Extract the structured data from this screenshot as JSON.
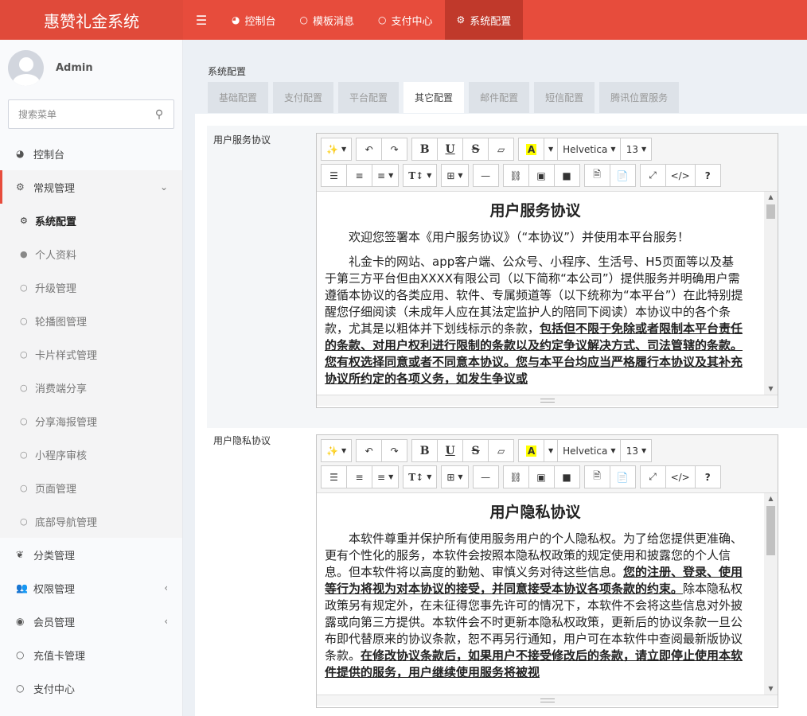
{
  "app": {
    "title": "惠赞礼金系统"
  },
  "topnav": {
    "items": [
      {
        "label": "控制台",
        "icon": "dashboard-icon"
      },
      {
        "label": "模板消息",
        "icon": "circle-icon"
      },
      {
        "label": "支付中心",
        "icon": "circle-icon"
      },
      {
        "label": "系统配置",
        "icon": "gear-icon"
      }
    ]
  },
  "user": {
    "name": "Admin"
  },
  "search": {
    "placeholder": "搜索菜单"
  },
  "sidebar": {
    "items": [
      {
        "label": "控制台"
      },
      {
        "label": "常规管理"
      },
      {
        "label": "系统配置"
      },
      {
        "label": "个人资料"
      },
      {
        "label": "升级管理"
      },
      {
        "label": "轮播图管理"
      },
      {
        "label": "卡片样式管理"
      },
      {
        "label": "消费端分享"
      },
      {
        "label": "分享海报管理"
      },
      {
        "label": "小程序审核"
      },
      {
        "label": "页面管理"
      },
      {
        "label": "底部导航管理"
      },
      {
        "label": "分类管理"
      },
      {
        "label": "权限管理"
      },
      {
        "label": "会员管理"
      },
      {
        "label": "充值卡管理"
      },
      {
        "label": "支付中心"
      }
    ]
  },
  "main": {
    "title": "系统配置",
    "tabs": [
      "基础配置",
      "支付配置",
      "平台配置",
      "其它配置",
      "邮件配置",
      "短信配置",
      "腾讯位置服务"
    ],
    "active_tab": "其它配置",
    "fields": [
      {
        "label": "用户服务协议",
        "doc_title": "用户服务协议",
        "p1": "欢迎您签署本《用户服务协议》（“本协议”）并使用本平台服务！",
        "p2_plain": "礼金卡的网站、app客户端、公众号、小程序、生活号、H5页面等以及基于第三方平台但由XXXX有限公司（以下简称“本公司”）提供服务并明确用户需遵循本协议的各类应用、软件、专属频道等（以下统称为“本平台”）在此特别提醒您仔细阅读（未成年人应在其法定监护人的陪同下阅读）本协议中的各个条款，尤其是以粗体并下划线标示的条款，",
        "p2_bold": "包括但不限于免除或者限制本平台责任的条款、对用户权利进行限制的条款以及约定争议解决方式、司法管辖的条款。您有权选择同意或者不同意本协议。您与本平台均应当严格履行本协议及其补充协议所约定的各项义务，如发生争议或"
      },
      {
        "label": "用户隐私协议",
        "doc_title": "用户隐私协议",
        "p1_plain": "本软件尊重并保护所有使用服务用户的个人隐私权。为了给您提供更准确、更有个性化的服务，本软件会按照本隐私权政策的规定使用和披露您的个人信息。但本软件将以高度的勤勉、审慎义务对待这些信息。",
        "p1_bold": "您的注册、登录、使用等行为将视为对本协议的接受，并同意接受本协议各项条款的约束。",
        "p1_plain2": "除本隐私权政策另有规定外，在未征得您事先许可的情况下，本软件不会将这些信息对外披露或向第三方提供。本软件会不时更新本隐私权政策，更新后的协议条款一旦公布即代替原来的协议条款，恕不再另行通知，用户可在本软件中查阅最新版协议条款。",
        "p1_bold2": "在修改协议条款后，如果用户不接受修改后的条款，请立即停止使用本软件提供的服务，用户继续使用服务将被视"
      }
    ]
  },
  "editor": {
    "font": "Helvetica",
    "size": "13"
  },
  "colors": {
    "brand": "#e74c3c",
    "highlight": "#ffff00"
  }
}
